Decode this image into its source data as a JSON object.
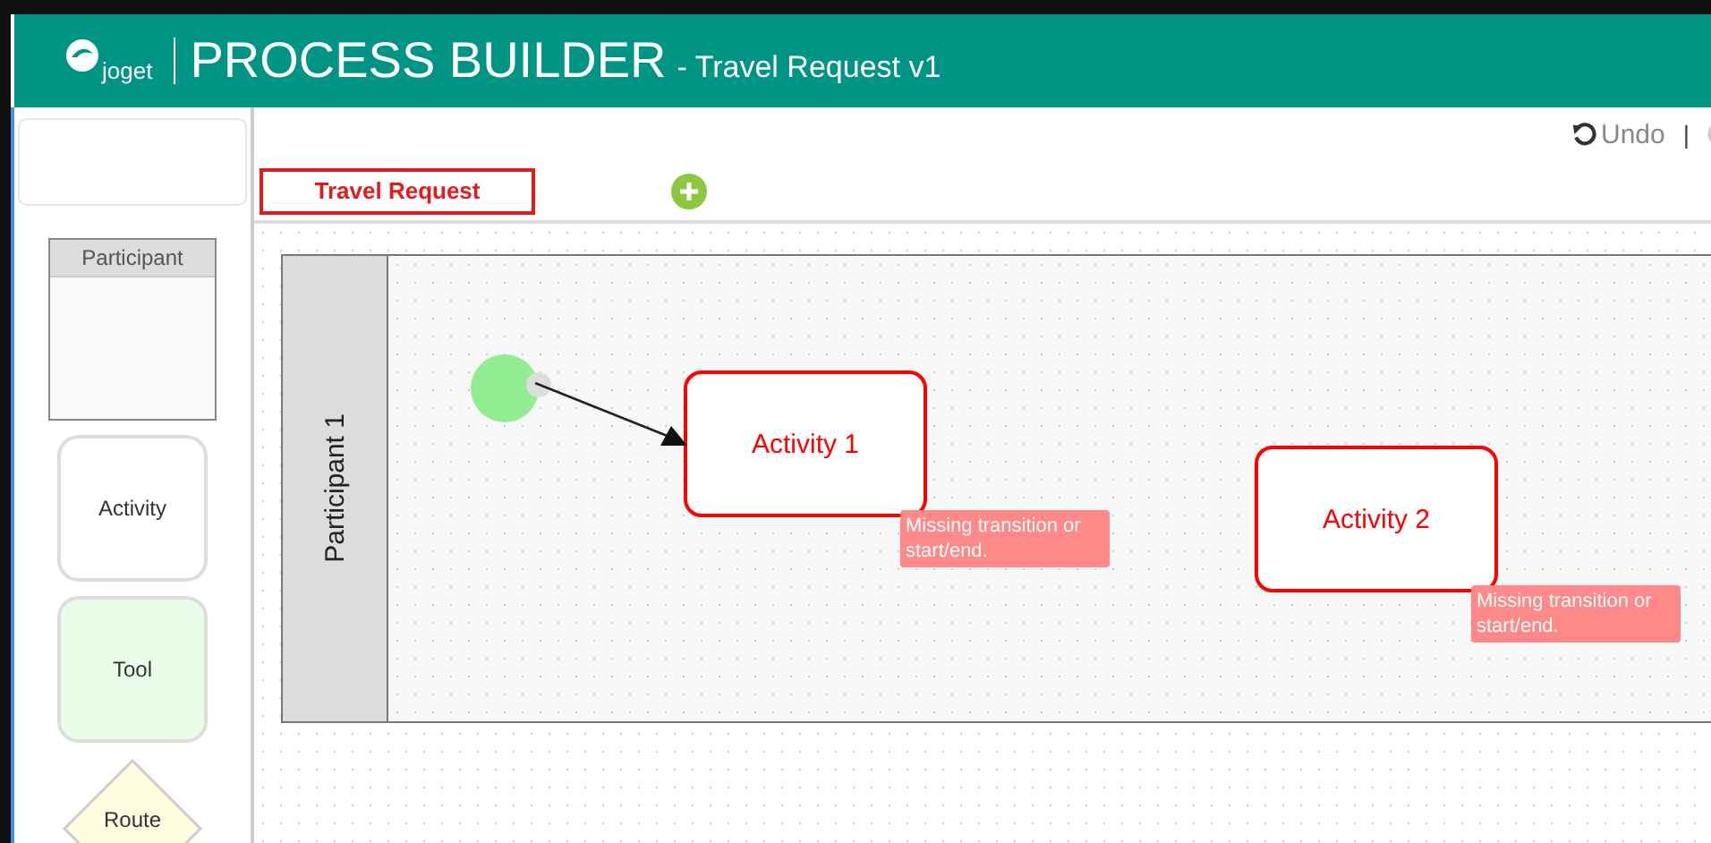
{
  "header": {
    "logo": "joget",
    "title": "PROCESS BUILDER",
    "subtitle": "- Travel Request v1"
  },
  "toolbar": {
    "undo": "Undo",
    "separator": "|"
  },
  "tabs": [
    {
      "label": "Travel Request",
      "selected": true
    }
  ],
  "palette": [
    {
      "kind": "participant",
      "label": "Participant"
    },
    {
      "kind": "activity",
      "label": "Activity"
    },
    {
      "kind": "tool",
      "label": "Tool"
    },
    {
      "kind": "route",
      "label": "Route"
    }
  ],
  "lanes": [
    {
      "name": "Participant 1"
    }
  ],
  "nodes": [
    {
      "kind": "start"
    },
    {
      "kind": "activity",
      "label": "Activity 1",
      "warning": "Missing transition or start/end."
    },
    {
      "kind": "activity",
      "label": "Activity 2",
      "warning": "Missing transition or start/end."
    }
  ]
}
